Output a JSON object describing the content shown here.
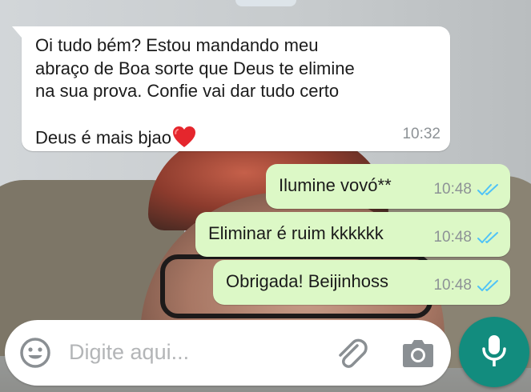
{
  "incoming": {
    "text": "Oi tudo bém?  Estou mandando meu\nabraço  de Boa sorte que Deus te elimine\nna sua prova. Confie vai dar tudo certo\nDeus é  mais bjao",
    "emoji": "red-heart",
    "time": "10:32"
  },
  "outgoing": [
    {
      "text": "Ilumine vovó**",
      "time": "10:48",
      "status": "read"
    },
    {
      "text": "Eliminar é ruim kkkkkk",
      "time": "10:48",
      "status": "read"
    },
    {
      "text": "Obrigada! Beijinhoss",
      "time": "10:48",
      "status": "read"
    }
  ],
  "composer": {
    "placeholder": "Digite aqui...",
    "icons": [
      "emoji-icon",
      "attach-icon",
      "camera-icon",
      "mic-icon"
    ]
  },
  "colors": {
    "incoming_bubble": "#ffffff",
    "outgoing_bubble": "#dcf8c6",
    "read_ticks": "#4fc3f7",
    "mic_button": "#128c7e",
    "timestamp": "#8d9296",
    "placeholder": "#b3b5b7"
  }
}
